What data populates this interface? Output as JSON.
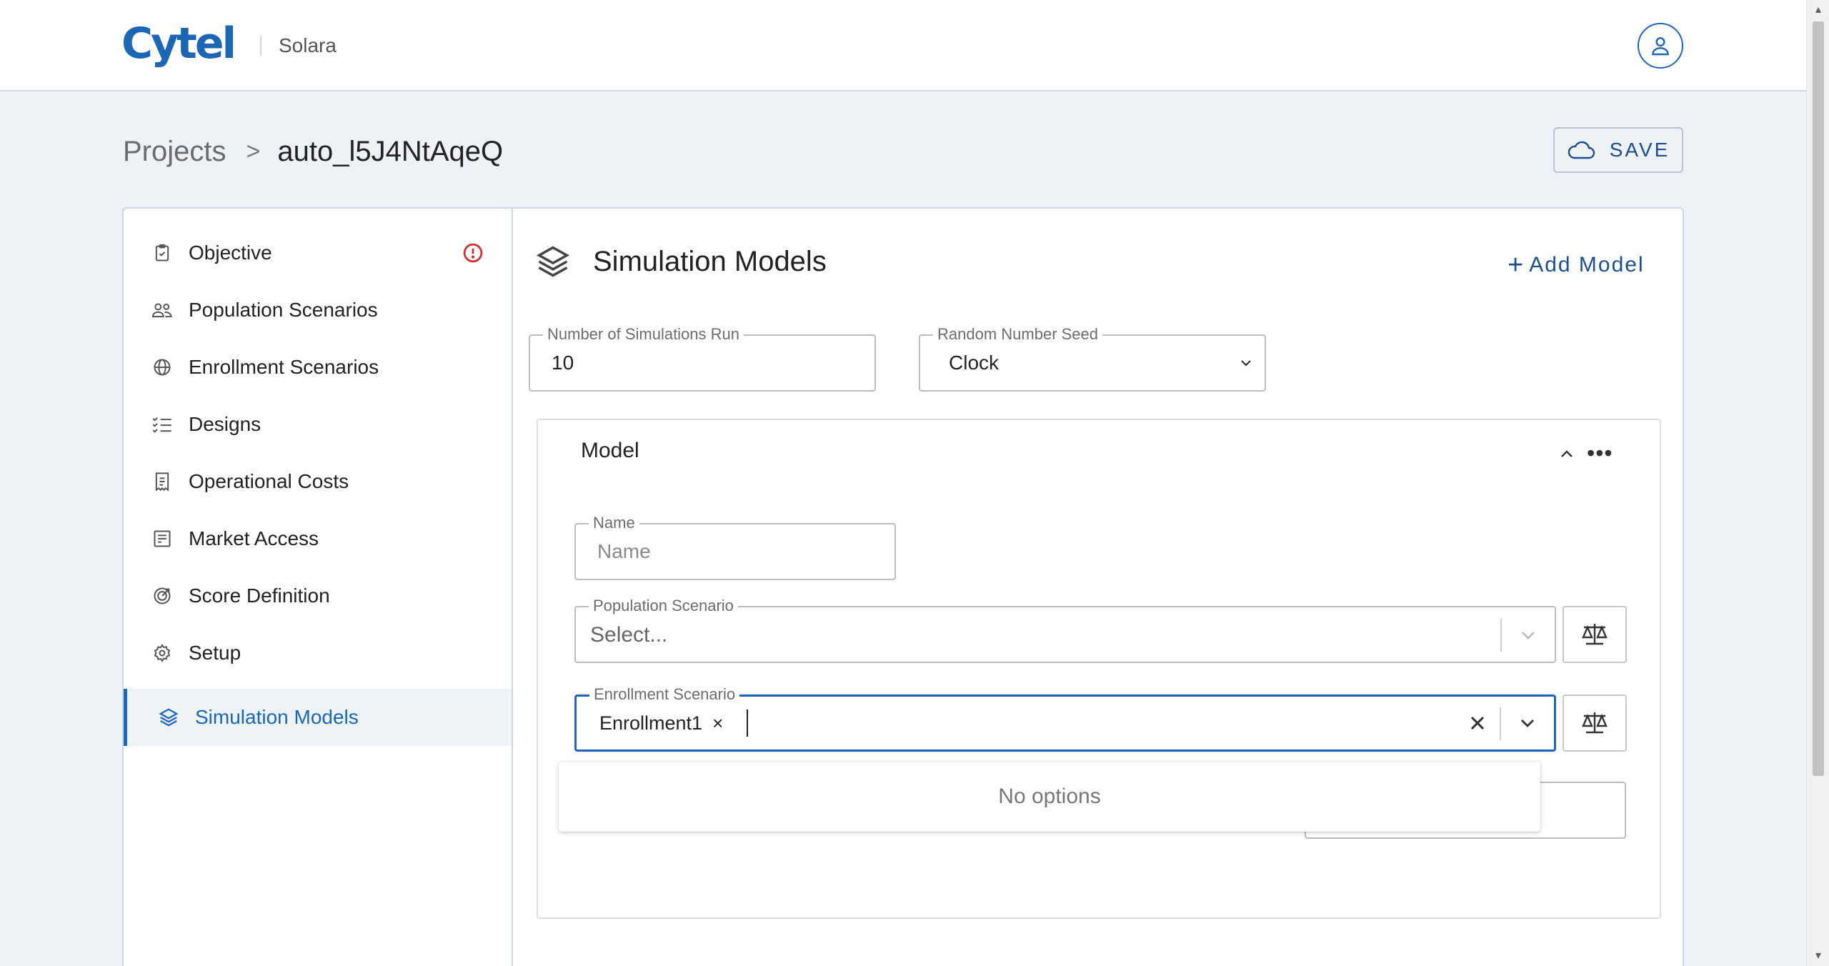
{
  "header": {
    "logo_text": "Cytel",
    "app_name": "Solara",
    "avatar_icon": "user-icon"
  },
  "breadcrumb": {
    "parent": "Projects",
    "separator": ">",
    "current": "auto_l5J4NtAqeQ"
  },
  "save_button": {
    "label": "SAVE",
    "icon": "cloud-icon"
  },
  "sidebar": {
    "items": [
      {
        "label": "Objective",
        "icon": "clipboard-check-icon",
        "warning": true
      },
      {
        "label": "Population Scenarios",
        "icon": "people-icon"
      },
      {
        "label": "Enrollment Scenarios",
        "icon": "globe-icon"
      },
      {
        "label": "Designs",
        "icon": "checklist-icon"
      },
      {
        "label": "Operational Costs",
        "icon": "receipt-icon"
      },
      {
        "label": "Market Access",
        "icon": "building-icon"
      },
      {
        "label": "Score Definition",
        "icon": "target-icon"
      },
      {
        "label": "Setup",
        "icon": "gear-icon"
      },
      {
        "label": "Simulation Models",
        "icon": "layers-icon",
        "active": true
      }
    ]
  },
  "main": {
    "title": "Simulation Models",
    "add_model_label": "Add Model",
    "num_simulations": {
      "label": "Number of Simulations Run",
      "value": "10"
    },
    "random_seed": {
      "label": "Random Number Seed",
      "value": "Clock"
    },
    "model": {
      "title": "Model",
      "name_field": {
        "label": "Name",
        "placeholder": "Name",
        "value": ""
      },
      "population_scenario": {
        "label": "Population Scenario",
        "placeholder": "Select..."
      },
      "enrollment_scenario": {
        "label": "Enrollment Scenario",
        "selected_chip": "Enrollment1",
        "chip_remove": "×"
      },
      "dropdown_message": "No options"
    }
  },
  "colors": {
    "accent": "#1c66b5",
    "warning": "#d32f2f",
    "background": "#eef1f5",
    "border": "#c9d9ea"
  }
}
